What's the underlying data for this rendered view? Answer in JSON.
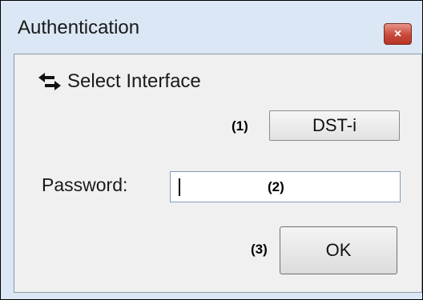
{
  "window": {
    "title": "Authentication",
    "close_glyph": "×"
  },
  "section": {
    "icon": "swap-arrows-icon",
    "label": "Select Interface"
  },
  "interface_button": {
    "marker": "(1)",
    "label": "DST-i"
  },
  "password": {
    "label": "Password:",
    "value": "",
    "marker": "(2)"
  },
  "ok_button": {
    "marker": "(3)",
    "label": "OK"
  },
  "colors": {
    "titlebar": "#dbe7f4",
    "client": "#f0f0f0",
    "close_button": "#c8483a",
    "input_border": "#7f9db9"
  }
}
